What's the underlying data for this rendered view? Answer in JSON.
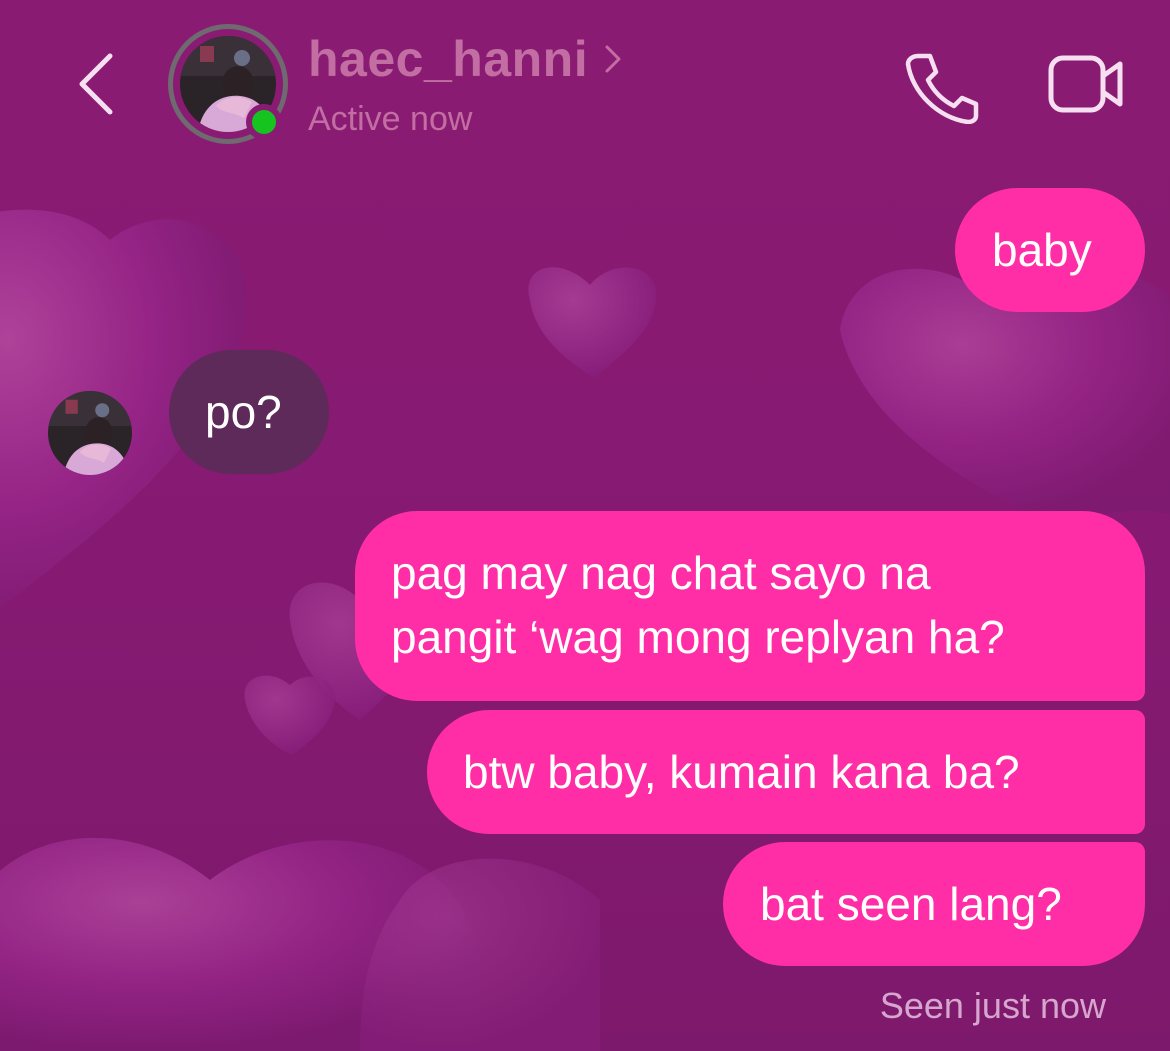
{
  "header": {
    "username": "haec_hanni",
    "status": "Active now",
    "back_icon": "chevron-left-icon",
    "profile_chevron_icon": "chevron-right-icon",
    "call_icon": "phone-icon",
    "video_icon": "video-camera-icon",
    "online_indicator_color": "#15c41f"
  },
  "messages": [
    {
      "direction": "sent",
      "text": "baby"
    },
    {
      "direction": "received",
      "text": "po?"
    },
    {
      "direction": "sent",
      "lines": [
        "pag may nag chat sayo na",
        "pangit ‘wag mong replyan ha?"
      ]
    },
    {
      "direction": "sent",
      "text": "btw baby, kumain kana ba?"
    },
    {
      "direction": "sent",
      "text": "bat seen lang?"
    }
  ],
  "receipt": "Seen just now",
  "colors": {
    "sent_bubble": "#ff2ea6",
    "received_bubble": "#5e2a5a",
    "background": "#8a1b73"
  }
}
